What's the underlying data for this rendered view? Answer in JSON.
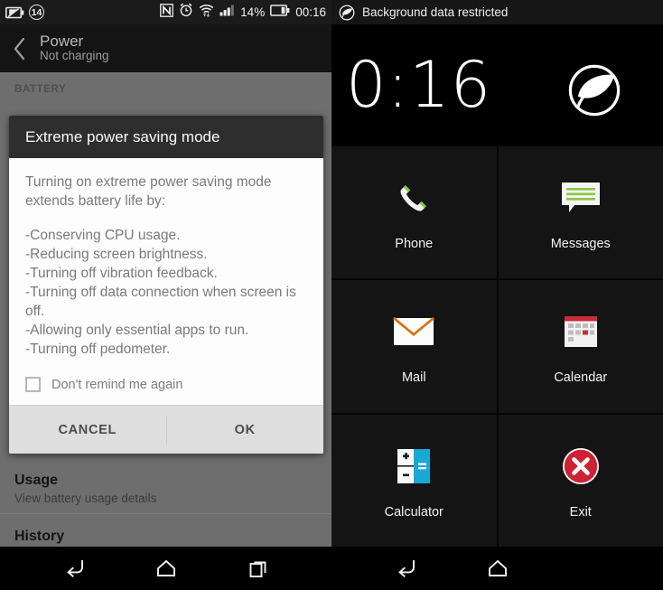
{
  "status_bar": {
    "left": {
      "eco_battery_icon": "battery-eco-icon",
      "notification_count": "14",
      "nfc_icon": "nfc-icon",
      "alarm_icon": "alarm-clock-icon",
      "wifi_icon": "wifi-data-icon",
      "signal_icon": "cell-signal-icon",
      "battery_percent": "14%",
      "battery_icon": "battery-icon",
      "clock": "00:16"
    },
    "right": {
      "eco_icon": "eco-leaf-icon",
      "message": "Background data restricted"
    }
  },
  "settings": {
    "back_icon": "back-chevron-icon",
    "title": "Power",
    "subtitle": "Not charging",
    "section_header": "BATTERY",
    "rows": [
      {
        "title": "Usage",
        "subtitle": "View battery usage details"
      },
      {
        "title": "History",
        "subtitle": ""
      }
    ]
  },
  "dialog": {
    "title": "Extreme power saving mode",
    "intro": "Turning on extreme power saving mode extends battery life by:",
    "items": [
      "-Conserving CPU usage.",
      "-Reducing screen brightness.",
      "-Turning off vibration feedback.",
      "-Turning off data connection when screen is off.",
      "-Allowing only essential apps to run.",
      "-Turning off pedometer."
    ],
    "checkbox_label": "Don't remind me again",
    "checkbox_checked": false,
    "cancel_label": "CANCEL",
    "ok_label": "OK"
  },
  "launcher": {
    "clock": "0:16",
    "eco_icon": "eco-leaf-icon",
    "tiles": [
      {
        "label": "Phone",
        "icon": "phone-handset-icon",
        "accent": "#8cc63e"
      },
      {
        "label": "Messages",
        "icon": "message-bubble-icon",
        "accent": "#8cc63e"
      },
      {
        "label": "Mail",
        "icon": "mail-envelope-icon",
        "accent": "#d4761a"
      },
      {
        "label": "Calendar",
        "icon": "calendar-icon",
        "accent": "#cc2b3d"
      },
      {
        "label": "Calculator",
        "icon": "calculator-icon",
        "accent": "#19a8d4"
      },
      {
        "label": "Exit",
        "icon": "exit-close-icon",
        "accent": "#cc2233"
      }
    ]
  },
  "nav_bar": {
    "left": [
      {
        "icon": "back-icon"
      },
      {
        "icon": "home-icon"
      },
      {
        "icon": "recents-icon"
      }
    ],
    "right": [
      {
        "icon": "back-icon"
      },
      {
        "icon": "home-icon"
      }
    ]
  },
  "colors": {
    "accent_green": "#8cc63e",
    "accent_red": "#cc2233",
    "accent_cyan": "#19a8d4",
    "accent_orange": "#d4761a",
    "dialog_header": "#2e2e2e",
    "dialog_buttons": "#dedede"
  }
}
